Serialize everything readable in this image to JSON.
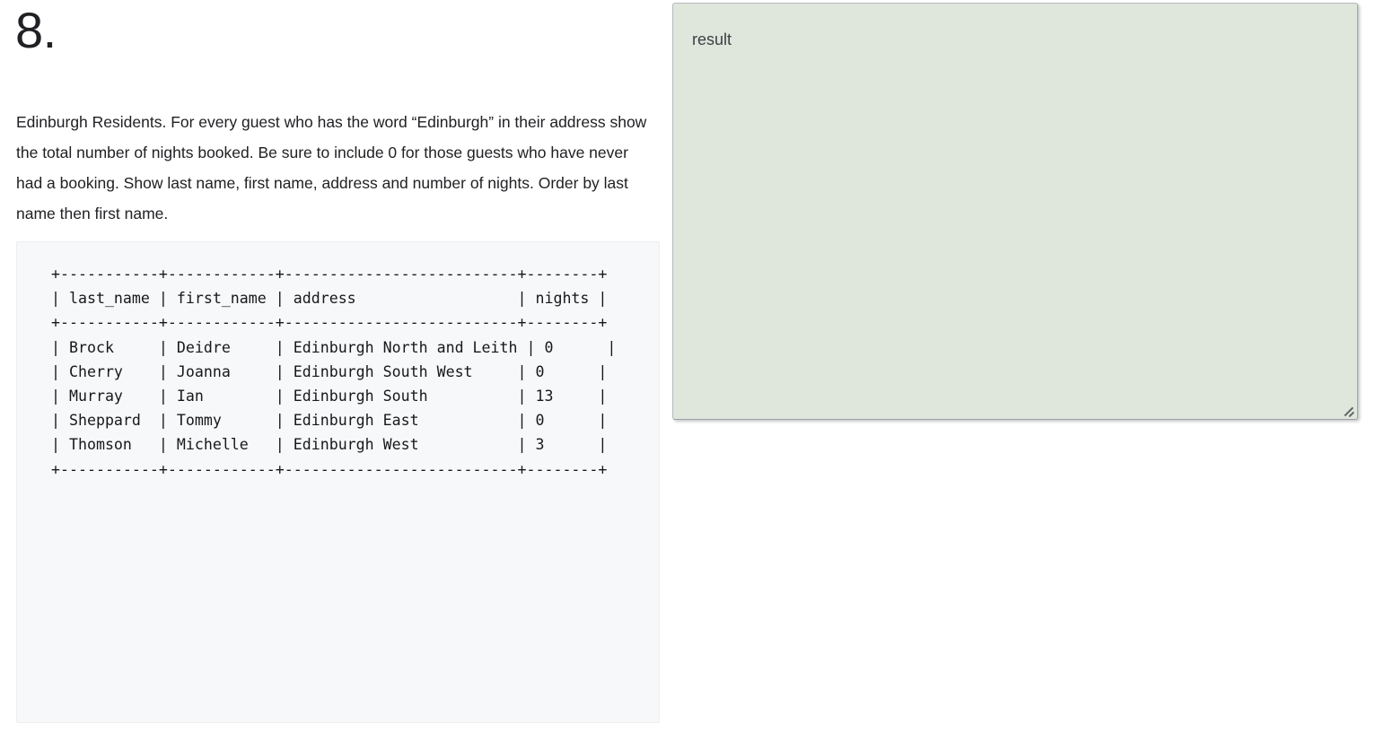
{
  "question": {
    "number": "8.",
    "prompt": "Edinburgh Residents. For every guest who has the word “Edinburgh” in their address show the total number of nights booked. Be sure to include 0 for those guests who have never had a booking. Show last name, first name, address and number of nights. Order by last name then first name."
  },
  "expected_output": {
    "separator": "+-----------+------------+--------------------------+--------+",
    "header_row": "| last_name | first_name | address                  | nights |",
    "columns": [
      "last_name",
      "first_name",
      "address",
      "nights"
    ],
    "rows": [
      {
        "last_name": "Brock",
        "first_name": "Deidre",
        "address": "Edinburgh North and Leith",
        "nights": "0"
      },
      {
        "last_name": "Cherry",
        "first_name": "Joanna",
        "address": "Edinburgh South West",
        "nights": "0"
      },
      {
        "last_name": "Murray",
        "first_name": "Ian",
        "address": "Edinburgh South",
        "nights": "13"
      },
      {
        "last_name": "Sheppard",
        "first_name": "Tommy",
        "address": "Edinburgh East",
        "nights": "0"
      },
      {
        "last_name": "Thomson",
        "first_name": "Michelle",
        "address": "Edinburgh West",
        "nights": "3"
      }
    ],
    "text": "+-----------+------------+--------------------------+--------+\n| last_name | first_name | address                  | nights |\n+-----------+------------+--------------------------+--------+\n| Brock     | Deidre     | Edinburgh North and Leith | 0      |\n| Cherry    | Joanna     | Edinburgh South West     | 0      |\n| Murray    | Ian        | Edinburgh South          | 13     |\n| Sheppard  | Tommy      | Edinburgh East           | 0      |\n| Thomson   | Michelle   | Edinburgh West           | 3      |\n+-----------+------------+--------------------------+--------+"
  },
  "answer_panel": {
    "placeholder": "result",
    "value": "",
    "background_color": "#dfe6dc",
    "resize_grip_icon": "resize-handle-icon"
  }
}
